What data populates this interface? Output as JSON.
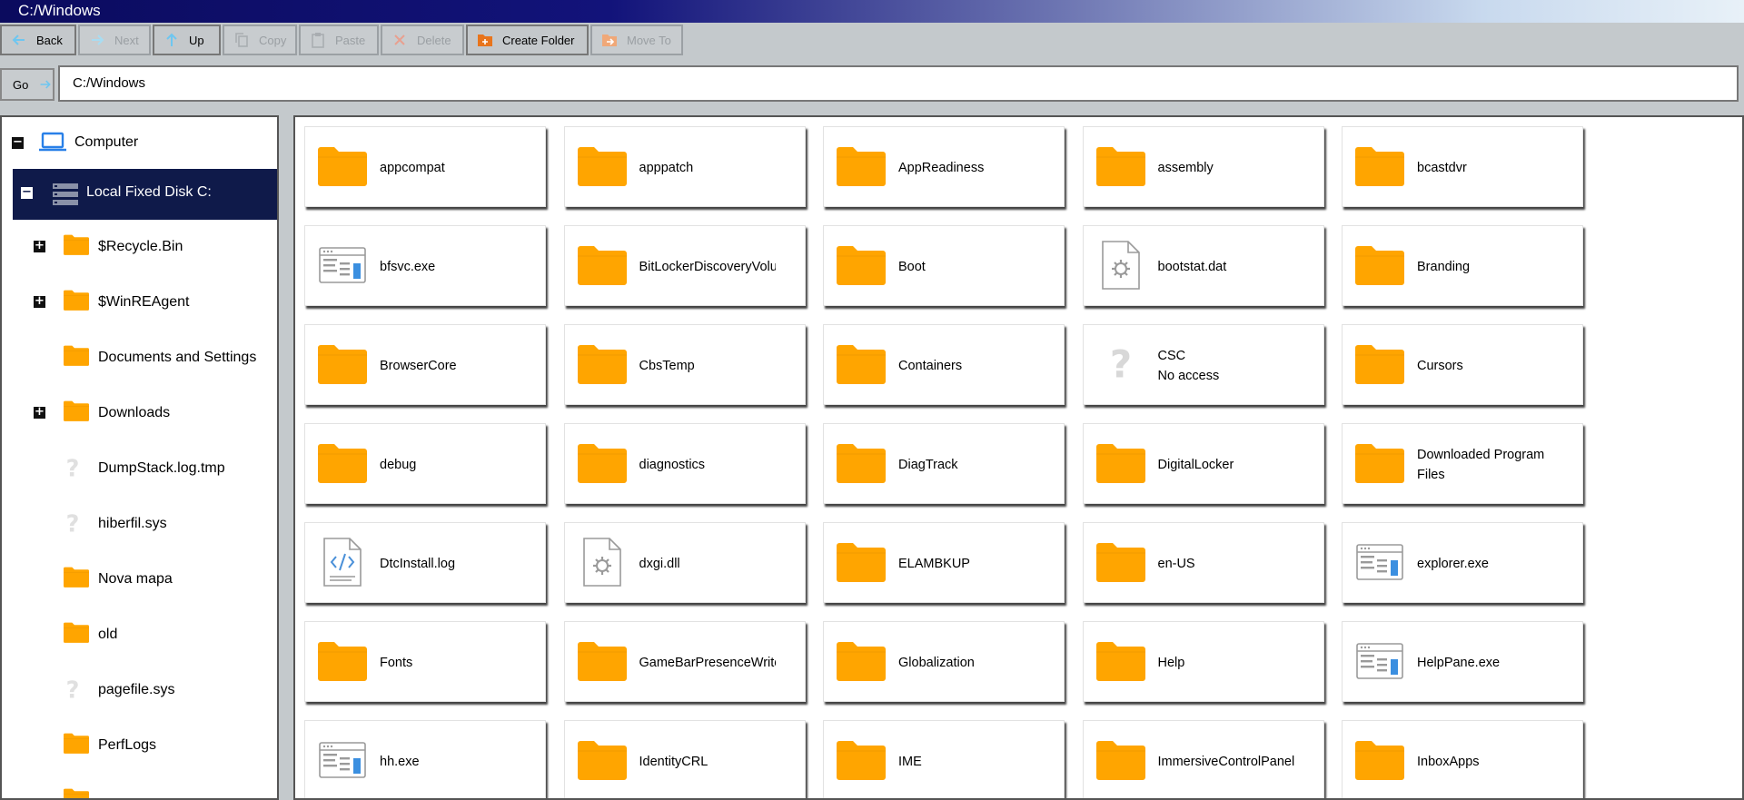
{
  "window": {
    "title": "C:/Windows"
  },
  "colors": {
    "folder": "#ffa500",
    "selection": "#0f1a4a",
    "accent_blue": "#2980e8"
  },
  "toolbar": {
    "buttons": [
      {
        "label": "Back",
        "icon": "arrow-left-icon",
        "enabled": true
      },
      {
        "label": "Next",
        "icon": "arrow-right-icon",
        "enabled": false
      },
      {
        "label": "Up",
        "icon": "arrow-up-icon",
        "enabled": true
      },
      {
        "label": "Copy",
        "icon": "copy-icon",
        "enabled": false
      },
      {
        "label": "Paste",
        "icon": "paste-icon",
        "enabled": false
      },
      {
        "label": "Delete",
        "icon": "delete-x-icon",
        "enabled": false
      },
      {
        "label": "Create Folder",
        "icon": "create-folder-icon",
        "enabled": true
      },
      {
        "label": "Move To",
        "icon": "move-to-icon",
        "enabled": false
      }
    ]
  },
  "address": {
    "go_label": "Go",
    "path": "C:/Windows"
  },
  "tree": {
    "root": {
      "label": "Computer",
      "icon": "laptop-icon",
      "expander": "minus"
    },
    "drive": {
      "label": "Local Fixed Disk C:",
      "icon": "drive-icon",
      "expander": "minus",
      "selected": true
    },
    "items": [
      {
        "label": "$Recycle.Bin",
        "icon": "folder-icon",
        "expander": "plus"
      },
      {
        "label": "$WinREAgent",
        "icon": "folder-icon",
        "expander": "plus"
      },
      {
        "label": "Documents and Settings",
        "icon": "folder-icon",
        "expander": ""
      },
      {
        "label": "Downloads",
        "icon": "folder-icon",
        "expander": "plus"
      },
      {
        "label": "DumpStack.log.tmp",
        "icon": "unknown-icon",
        "expander": ""
      },
      {
        "label": "hiberfil.sys",
        "icon": "unknown-icon",
        "expander": ""
      },
      {
        "label": "Nova mapa",
        "icon": "folder-icon",
        "expander": ""
      },
      {
        "label": "old",
        "icon": "folder-icon",
        "expander": ""
      },
      {
        "label": "pagefile.sys",
        "icon": "unknown-icon",
        "expander": ""
      },
      {
        "label": "PerfLogs",
        "icon": "folder-icon",
        "expander": ""
      },
      {
        "label": "",
        "icon": "folder-icon",
        "expander": ""
      }
    ]
  },
  "files": [
    {
      "name": "appcompat",
      "icon": "folder-icon"
    },
    {
      "name": "apppatch",
      "icon": "folder-icon"
    },
    {
      "name": "AppReadiness",
      "icon": "folder-icon"
    },
    {
      "name": "assembly",
      "icon": "folder-icon"
    },
    {
      "name": "bcastdvr",
      "icon": "folder-icon"
    },
    {
      "name": "bfsvc.exe",
      "icon": "exe-icon"
    },
    {
      "name": "BitLockerDiscoveryVolu",
      "icon": "folder-icon"
    },
    {
      "name": "Boot",
      "icon": "folder-icon"
    },
    {
      "name": "bootstat.dat",
      "icon": "settings-file-icon"
    },
    {
      "name": "Branding",
      "icon": "folder-icon"
    },
    {
      "name": "BrowserCore",
      "icon": "folder-icon"
    },
    {
      "name": "CbsTemp",
      "icon": "folder-icon"
    },
    {
      "name": "Containers",
      "icon": "folder-icon"
    },
    {
      "name": "CSC",
      "icon": "unknown-icon",
      "note": "No access"
    },
    {
      "name": "Cursors",
      "icon": "folder-icon"
    },
    {
      "name": "debug",
      "icon": "folder-icon"
    },
    {
      "name": "diagnostics",
      "icon": "folder-icon"
    },
    {
      "name": "DiagTrack",
      "icon": "folder-icon"
    },
    {
      "name": "DigitalLocker",
      "icon": "folder-icon"
    },
    {
      "name": "Downloaded Program Files",
      "icon": "folder-icon"
    },
    {
      "name": "DtcInstall.log",
      "icon": "code-file-icon"
    },
    {
      "name": "dxgi.dll",
      "icon": "settings-file-icon"
    },
    {
      "name": "ELAMBKUP",
      "icon": "folder-icon"
    },
    {
      "name": "en-US",
      "icon": "folder-icon"
    },
    {
      "name": "explorer.exe",
      "icon": "exe-icon"
    },
    {
      "name": "Fonts",
      "icon": "folder-icon"
    },
    {
      "name": "GameBarPresenceWrite",
      "icon": "folder-icon"
    },
    {
      "name": "Globalization",
      "icon": "folder-icon"
    },
    {
      "name": "Help",
      "icon": "folder-icon"
    },
    {
      "name": "HelpPane.exe",
      "icon": "exe-icon"
    },
    {
      "name": "hh.exe",
      "icon": "exe-icon"
    },
    {
      "name": "IdentityCRL",
      "icon": "folder-icon"
    },
    {
      "name": "IME",
      "icon": "folder-icon"
    },
    {
      "name": "ImmersiveControlPanel",
      "icon": "folder-icon"
    },
    {
      "name": "InboxApps",
      "icon": "folder-icon"
    }
  ]
}
